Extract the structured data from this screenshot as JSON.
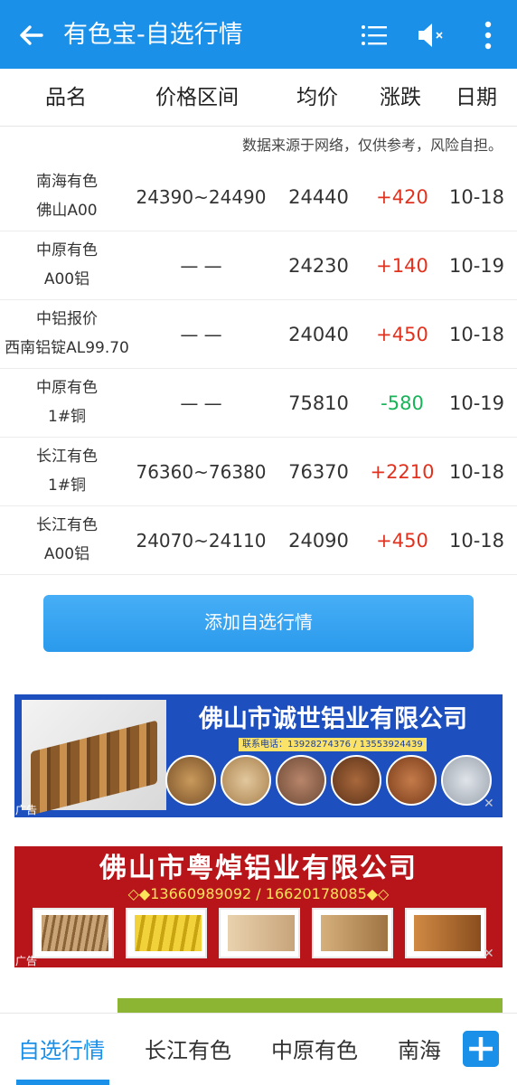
{
  "appbar": {
    "title": "有色宝-自选行情",
    "icons": [
      "back-arrow-icon",
      "list-menu-icon",
      "volume-mute-icon",
      "more-vertical-icon"
    ]
  },
  "table": {
    "headers": [
      "品名",
      "价格区间",
      "均价",
      "涨跌",
      "日期"
    ],
    "notice": "数据来源于网络，仅供参考，风险自担。",
    "rows": [
      {
        "name1": "南海有色",
        "name2": "佛山A00",
        "range": "24390~24490",
        "avg": "24440",
        "change": "+420",
        "date": "10-18",
        "trend": "up"
      },
      {
        "name1": "中原有色",
        "name2": "A00铝",
        "range": "— —",
        "avg": "24230",
        "change": "+140",
        "date": "10-19",
        "trend": "up"
      },
      {
        "name1": "中铝报价",
        "name2": "西南铝锭AL99.70",
        "range": "— —",
        "avg": "24040",
        "change": "+450",
        "date": "10-18",
        "trend": "up"
      },
      {
        "name1": "中原有色",
        "name2": "1#铜",
        "range": "— —",
        "avg": "75810",
        "change": "-580",
        "date": "10-19",
        "trend": "down"
      },
      {
        "name1": "长江有色",
        "name2": "1#铜",
        "range": "76360~76380",
        "avg": "76370",
        "change": "+2210",
        "date": "10-18",
        "trend": "up"
      },
      {
        "name1": "长江有色",
        "name2": "A00铝",
        "range": "24070~24110",
        "avg": "24090",
        "change": "+450",
        "date": "10-18",
        "trend": "up"
      }
    ]
  },
  "add_button": "添加自选行情",
  "ads": [
    {
      "company": "佛山市诚世铝业有限公司",
      "contact": "联系电话：13928274376 / 13553924439",
      "label": "广告"
    },
    {
      "company": "佛山市粤焯铝业有限公司",
      "phones": "◇◆13660989092 / 16620178085◆◇",
      "label": "广告"
    }
  ],
  "tabs": [
    "自选行情",
    "长江有色",
    "中原有色",
    "南海"
  ],
  "colors": {
    "primary": "#1a90e8",
    "up": "#e0321e",
    "down": "#19b35a"
  }
}
